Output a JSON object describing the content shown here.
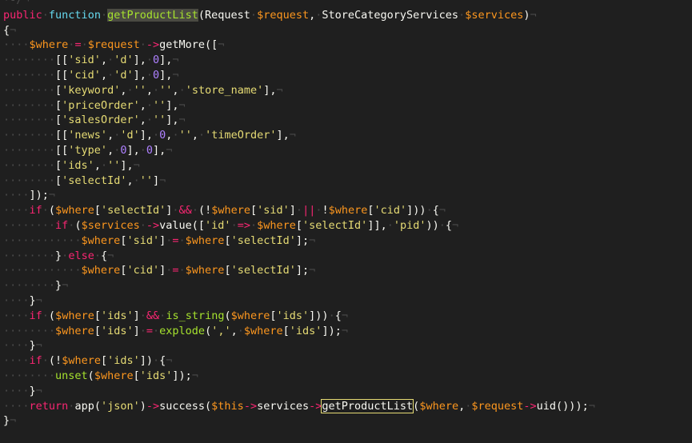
{
  "editor": {
    "colors": {
      "background": "#1f1f1f",
      "keyword": "#f92672",
      "storage": "#66d9ef",
      "function": "#a6e22e",
      "variable": "#fd971f",
      "string": "#e6db74",
      "number": "#ae81ff",
      "plain": "#f8f8f2",
      "whitespace_marker": "#4a4a4a"
    },
    "lines": [
      [
        [
          "ws",
          "·-/¬"
        ]
      ],
      [
        [
          "kw",
          "public"
        ],
        [
          "ws",
          "·"
        ],
        [
          "st",
          "function"
        ],
        [
          "ws",
          "·"
        ],
        [
          "fn",
          "getProductList",
          "sel"
        ],
        [
          "pl",
          "(Request"
        ],
        [
          "ws",
          "·"
        ],
        [
          "var",
          "$request"
        ],
        [
          "pl",
          ","
        ],
        [
          "ws",
          "·"
        ],
        [
          "pl",
          "StoreCategoryServices"
        ],
        [
          "ws",
          "·"
        ],
        [
          "var",
          "$services"
        ],
        [
          "pl",
          ")"
        ],
        [
          "ws",
          "¬"
        ]
      ],
      [
        [
          "pl",
          "{"
        ],
        [
          "ws",
          "¬"
        ]
      ],
      [
        [
          "ws",
          "····"
        ],
        [
          "var",
          "$where"
        ],
        [
          "ws",
          "·"
        ],
        [
          "kw",
          "="
        ],
        [
          "ws",
          "·"
        ],
        [
          "var",
          "$request"
        ],
        [
          "ws",
          "·"
        ],
        [
          "kw",
          "->"
        ],
        [
          "pl",
          "getMore(["
        ],
        [
          "ws",
          "¬"
        ]
      ],
      [
        [
          "ws",
          "········"
        ],
        [
          "pl",
          "[["
        ],
        [
          "str",
          "'sid'"
        ],
        [
          "pl",
          ","
        ],
        [
          "ws",
          "·"
        ],
        [
          "str",
          "'d'"
        ],
        [
          "pl",
          "],"
        ],
        [
          "ws",
          "·"
        ],
        [
          "num",
          "0"
        ],
        [
          "pl",
          "],"
        ],
        [
          "ws",
          "¬"
        ]
      ],
      [
        [
          "ws",
          "········"
        ],
        [
          "pl",
          "[["
        ],
        [
          "str",
          "'cid'"
        ],
        [
          "pl",
          ","
        ],
        [
          "ws",
          "·"
        ],
        [
          "str",
          "'d'"
        ],
        [
          "pl",
          "],"
        ],
        [
          "ws",
          "·"
        ],
        [
          "num",
          "0"
        ],
        [
          "pl",
          "],"
        ],
        [
          "ws",
          "¬"
        ]
      ],
      [
        [
          "ws",
          "········"
        ],
        [
          "pl",
          "["
        ],
        [
          "str",
          "'keyword'"
        ],
        [
          "pl",
          ","
        ],
        [
          "ws",
          "·"
        ],
        [
          "str",
          "''"
        ],
        [
          "pl",
          ","
        ],
        [
          "ws",
          "·"
        ],
        [
          "str",
          "''"
        ],
        [
          "pl",
          ","
        ],
        [
          "ws",
          "·"
        ],
        [
          "str",
          "'store_name'"
        ],
        [
          "pl",
          "],"
        ],
        [
          "ws",
          "¬"
        ]
      ],
      [
        [
          "ws",
          "········"
        ],
        [
          "pl",
          "["
        ],
        [
          "str",
          "'priceOrder'"
        ],
        [
          "pl",
          ","
        ],
        [
          "ws",
          "·"
        ],
        [
          "str",
          "''"
        ],
        [
          "pl",
          "],"
        ],
        [
          "ws",
          "¬"
        ]
      ],
      [
        [
          "ws",
          "········"
        ],
        [
          "pl",
          "["
        ],
        [
          "str",
          "'salesOrder'"
        ],
        [
          "pl",
          ","
        ],
        [
          "ws",
          "·"
        ],
        [
          "str",
          "''"
        ],
        [
          "pl",
          "],"
        ],
        [
          "ws",
          "¬"
        ]
      ],
      [
        [
          "ws",
          "········"
        ],
        [
          "pl",
          "[["
        ],
        [
          "str",
          "'news'"
        ],
        [
          "pl",
          ","
        ],
        [
          "ws",
          "·"
        ],
        [
          "str",
          "'d'"
        ],
        [
          "pl",
          "],"
        ],
        [
          "ws",
          "·"
        ],
        [
          "num",
          "0"
        ],
        [
          "pl",
          ","
        ],
        [
          "ws",
          "·"
        ],
        [
          "str",
          "''"
        ],
        [
          "pl",
          ","
        ],
        [
          "ws",
          "·"
        ],
        [
          "str",
          "'timeOrder'"
        ],
        [
          "pl",
          "],"
        ],
        [
          "ws",
          "¬"
        ]
      ],
      [
        [
          "ws",
          "········"
        ],
        [
          "pl",
          "[["
        ],
        [
          "str",
          "'type'"
        ],
        [
          "pl",
          ","
        ],
        [
          "ws",
          "·"
        ],
        [
          "num",
          "0"
        ],
        [
          "pl",
          "],"
        ],
        [
          "ws",
          "·"
        ],
        [
          "num",
          "0"
        ],
        [
          "pl",
          "],"
        ],
        [
          "ws",
          "¬"
        ]
      ],
      [
        [
          "ws",
          "········"
        ],
        [
          "pl",
          "["
        ],
        [
          "str",
          "'ids'"
        ],
        [
          "pl",
          ","
        ],
        [
          "ws",
          "·"
        ],
        [
          "str",
          "''"
        ],
        [
          "pl",
          "],"
        ],
        [
          "ws",
          "¬"
        ]
      ],
      [
        [
          "ws",
          "········"
        ],
        [
          "pl",
          "["
        ],
        [
          "str",
          "'selectId'"
        ],
        [
          "pl",
          ","
        ],
        [
          "ws",
          "·"
        ],
        [
          "str",
          "''"
        ],
        [
          "pl",
          "]"
        ],
        [
          "ws",
          "¬"
        ]
      ],
      [
        [
          "ws",
          "····"
        ],
        [
          "pl",
          "]);"
        ],
        [
          "ws",
          "¬"
        ]
      ],
      [
        [
          "ws",
          "····"
        ],
        [
          "kw",
          "if"
        ],
        [
          "ws",
          "·"
        ],
        [
          "pl",
          "("
        ],
        [
          "var",
          "$where"
        ],
        [
          "pl",
          "["
        ],
        [
          "str",
          "'selectId'"
        ],
        [
          "pl",
          "]"
        ],
        [
          "ws",
          "·"
        ],
        [
          "kw",
          "&&"
        ],
        [
          "ws",
          "·"
        ],
        [
          "pl",
          "(!"
        ],
        [
          "var",
          "$where"
        ],
        [
          "pl",
          "["
        ],
        [
          "str",
          "'sid'"
        ],
        [
          "pl",
          "]"
        ],
        [
          "ws",
          "·"
        ],
        [
          "kw",
          "||"
        ],
        [
          "ws",
          "·"
        ],
        [
          "pl",
          "!"
        ],
        [
          "var",
          "$where"
        ],
        [
          "pl",
          "["
        ],
        [
          "str",
          "'cid'"
        ],
        [
          "pl",
          "]))"
        ],
        [
          "ws",
          "·"
        ],
        [
          "pl",
          "{"
        ],
        [
          "ws",
          "¬"
        ]
      ],
      [
        [
          "ws",
          "········"
        ],
        [
          "kw",
          "if"
        ],
        [
          "ws",
          "·"
        ],
        [
          "pl",
          "("
        ],
        [
          "var",
          "$services"
        ],
        [
          "ws",
          "·"
        ],
        [
          "kw",
          "->"
        ],
        [
          "pl",
          "value(["
        ],
        [
          "str",
          "'id'"
        ],
        [
          "ws",
          "·"
        ],
        [
          "kw",
          "=>"
        ],
        [
          "ws",
          "·"
        ],
        [
          "var",
          "$where"
        ],
        [
          "pl",
          "["
        ],
        [
          "str",
          "'selectId'"
        ],
        [
          "pl",
          "]],"
        ],
        [
          "ws",
          "·"
        ],
        [
          "str",
          "'pid'"
        ],
        [
          "pl",
          "))"
        ],
        [
          "ws",
          "·"
        ],
        [
          "pl",
          "{"
        ],
        [
          "ws",
          "¬"
        ]
      ],
      [
        [
          "ws",
          "············"
        ],
        [
          "var",
          "$where"
        ],
        [
          "pl",
          "["
        ],
        [
          "str",
          "'sid'"
        ],
        [
          "pl",
          "]"
        ],
        [
          "ws",
          "·"
        ],
        [
          "kw",
          "="
        ],
        [
          "ws",
          "·"
        ],
        [
          "var",
          "$where"
        ],
        [
          "pl",
          "["
        ],
        [
          "str",
          "'selectId'"
        ],
        [
          "pl",
          "];"
        ],
        [
          "ws",
          "¬"
        ]
      ],
      [
        [
          "ws",
          "········"
        ],
        [
          "pl",
          "}"
        ],
        [
          "ws",
          "·"
        ],
        [
          "kw",
          "else"
        ],
        [
          "ws",
          "·"
        ],
        [
          "pl",
          "{"
        ],
        [
          "ws",
          "¬"
        ]
      ],
      [
        [
          "ws",
          "············"
        ],
        [
          "var",
          "$where"
        ],
        [
          "pl",
          "["
        ],
        [
          "str",
          "'cid'"
        ],
        [
          "pl",
          "]"
        ],
        [
          "ws",
          "·"
        ],
        [
          "kw",
          "="
        ],
        [
          "ws",
          "·"
        ],
        [
          "var",
          "$where"
        ],
        [
          "pl",
          "["
        ],
        [
          "str",
          "'selectId'"
        ],
        [
          "pl",
          "];"
        ],
        [
          "ws",
          "¬"
        ]
      ],
      [
        [
          "ws",
          "········"
        ],
        [
          "pl",
          "}"
        ],
        [
          "ws",
          "¬"
        ]
      ],
      [
        [
          "ws",
          "····"
        ],
        [
          "pl",
          "}"
        ],
        [
          "ws",
          "¬"
        ]
      ],
      [
        [
          "ws",
          "····"
        ],
        [
          "kw",
          "if"
        ],
        [
          "ws",
          "·"
        ],
        [
          "pl",
          "("
        ],
        [
          "var",
          "$where"
        ],
        [
          "pl",
          "["
        ],
        [
          "str",
          "'ids'"
        ],
        [
          "pl",
          "]"
        ],
        [
          "ws",
          "·"
        ],
        [
          "kw",
          "&&"
        ],
        [
          "ws",
          "·"
        ],
        [
          "fn",
          "is_string"
        ],
        [
          "pl",
          "("
        ],
        [
          "var",
          "$where"
        ],
        [
          "pl",
          "["
        ],
        [
          "str",
          "'ids'"
        ],
        [
          "pl",
          "]))"
        ],
        [
          "ws",
          "·"
        ],
        [
          "pl",
          "{"
        ],
        [
          "ws",
          "¬"
        ]
      ],
      [
        [
          "ws",
          "········"
        ],
        [
          "var",
          "$where"
        ],
        [
          "pl",
          "["
        ],
        [
          "str",
          "'ids'"
        ],
        [
          "pl",
          "]"
        ],
        [
          "ws",
          "·"
        ],
        [
          "kw",
          "="
        ],
        [
          "ws",
          "·"
        ],
        [
          "fn",
          "explode"
        ],
        [
          "pl",
          "("
        ],
        [
          "str",
          "','"
        ],
        [
          "pl",
          ","
        ],
        [
          "ws",
          "·"
        ],
        [
          "var",
          "$where"
        ],
        [
          "pl",
          "["
        ],
        [
          "str",
          "'ids'"
        ],
        [
          "pl",
          "]);"
        ],
        [
          "ws",
          "¬"
        ]
      ],
      [
        [
          "ws",
          "····"
        ],
        [
          "pl",
          "}"
        ],
        [
          "ws",
          "¬"
        ]
      ],
      [
        [
          "ws",
          "····"
        ],
        [
          "kw",
          "if"
        ],
        [
          "ws",
          "·"
        ],
        [
          "pl",
          "(!"
        ],
        [
          "var",
          "$where"
        ],
        [
          "pl",
          "["
        ],
        [
          "str",
          "'ids'"
        ],
        [
          "pl",
          "])"
        ],
        [
          "ws",
          "·"
        ],
        [
          "pl",
          "{"
        ],
        [
          "ws",
          "¬"
        ]
      ],
      [
        [
          "ws",
          "········"
        ],
        [
          "fn",
          "unset"
        ],
        [
          "pl",
          "("
        ],
        [
          "var",
          "$where"
        ],
        [
          "pl",
          "["
        ],
        [
          "str",
          "'ids'"
        ],
        [
          "pl",
          "]);"
        ],
        [
          "ws",
          "¬"
        ]
      ],
      [
        [
          "ws",
          "····"
        ],
        [
          "pl",
          "}"
        ],
        [
          "ws",
          "¬"
        ]
      ],
      [
        [
          "ws",
          "····"
        ],
        [
          "kw",
          "return"
        ],
        [
          "ws",
          "·"
        ],
        [
          "pl",
          "app("
        ],
        [
          "str",
          "'json'"
        ],
        [
          "pl",
          ")"
        ],
        [
          "kw",
          "->"
        ],
        [
          "pl",
          "success("
        ],
        [
          "var",
          "$this"
        ],
        [
          "kw",
          "->"
        ],
        [
          "pl",
          "services"
        ],
        [
          "kw",
          "->"
        ],
        [
          "pl",
          "getProductList",
          "box"
        ],
        [
          "pl",
          "("
        ],
        [
          "var",
          "$where"
        ],
        [
          "pl",
          ","
        ],
        [
          "ws",
          "·"
        ],
        [
          "var",
          "$request"
        ],
        [
          "kw",
          "->"
        ],
        [
          "pl",
          "uid()));"
        ],
        [
          "ws",
          "¬"
        ]
      ],
      [
        [
          "pl",
          "}"
        ],
        [
          "ws",
          "¬"
        ]
      ]
    ]
  }
}
